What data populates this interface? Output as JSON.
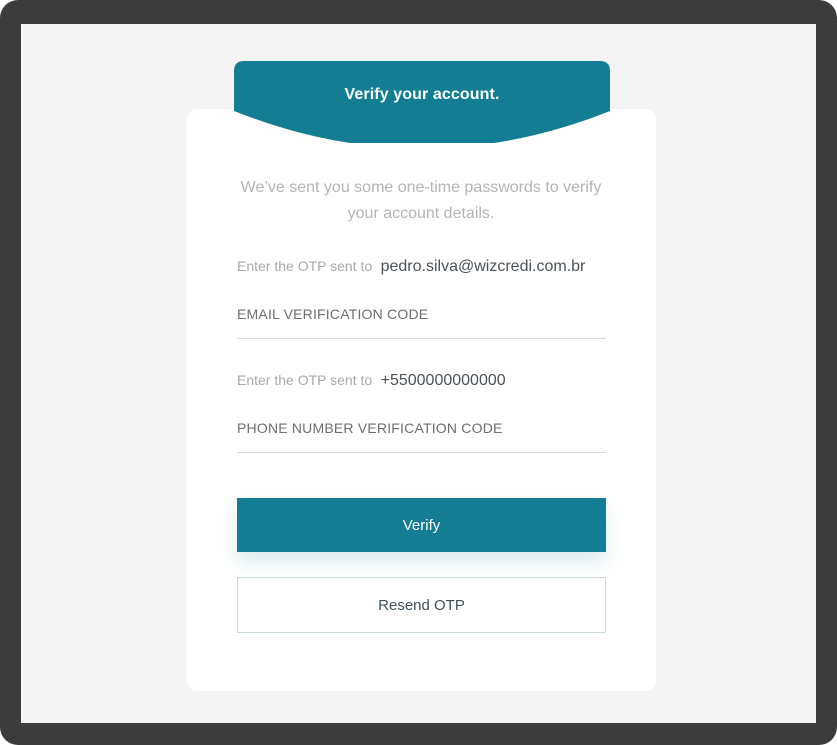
{
  "header": {
    "title": "Verify your account."
  },
  "intro": {
    "text": "We’ve sent you some one-time passwords to verify your account details."
  },
  "email_otp": {
    "prefix": "Enter the OTP sent to",
    "target": "pedro.silva@wizcredi.com.br",
    "field_label": "EMAIL VERIFICATION CODE",
    "value": ""
  },
  "phone_otp": {
    "prefix": "Enter the OTP sent to",
    "target": "+5500000000000",
    "field_label": "PHONE NUMBER VERIFICATION CODE",
    "value": ""
  },
  "actions": {
    "verify_label": "Verify",
    "resend_label": "Resend OTP"
  },
  "colors": {
    "primary": "#137d93",
    "window_frame": "#3c3c3c",
    "page_background": "#f4f4f4",
    "card": "#ffffff"
  }
}
